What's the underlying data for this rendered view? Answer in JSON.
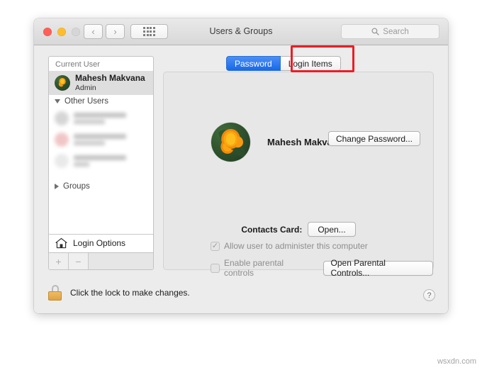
{
  "window": {
    "title": "Users & Groups",
    "traffic_lights": [
      "close",
      "minimize",
      "zoom"
    ],
    "nav": {
      "back": "‹",
      "forward": "›",
      "show_all": "show-all-grid"
    },
    "search": {
      "placeholder": "Search",
      "icon": "search-icon"
    }
  },
  "sidebar": {
    "current_user_header": "Current User",
    "current_user": {
      "name": "Mahesh Makvana",
      "role": "Admin"
    },
    "other_users_header": "Other Users",
    "other_users": [
      {
        "name": "",
        "role": "",
        "avatar_color": "#bdbdbd"
      },
      {
        "name": "",
        "role": "",
        "avatar_color": "#e8a3a3"
      },
      {
        "name": "",
        "role": "",
        "avatar_color": "#dcdcdc"
      }
    ],
    "groups_header": "Groups",
    "login_options": "Login Options",
    "add_button": "+",
    "remove_button": "−"
  },
  "tabs": [
    {
      "label": "Password",
      "active": true
    },
    {
      "label": "Login Items",
      "active": false,
      "highlighted": true
    }
  ],
  "profile": {
    "name": "Mahesh Makvana",
    "avatar": "flower-avatar",
    "change_password_label": "Change Password..."
  },
  "settings": {
    "contacts_card_label": "Contacts Card:",
    "contacts_open_label": "Open...",
    "admin_checkbox_label": "Allow user to administer this computer",
    "admin_checkbox_checked": true,
    "admin_checkbox_mark": "✓",
    "parental_checkbox_label": "Enable parental controls",
    "parental_checkbox_checked": false,
    "parental_button_label": "Open Parental Controls..."
  },
  "footer": {
    "lock_text": "Click the lock to make changes.",
    "lock_icon": "locked-padlock",
    "help_label": "?"
  },
  "watermark": "wsxdn.com",
  "colors": {
    "accent_blue": "#1769e8",
    "highlight_red": "#ee1c25",
    "lock_gold": "#e0a341",
    "window_bg": "#ececec"
  }
}
